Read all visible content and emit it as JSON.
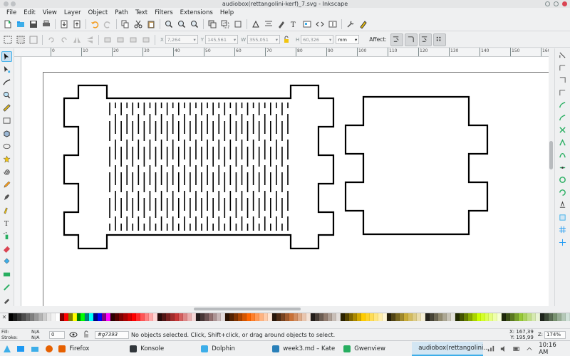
{
  "window": {
    "title": "audiobox(rettangolini-kerf)_7.svg - Inkscape"
  },
  "menu": [
    "File",
    "Edit",
    "View",
    "Layer",
    "Object",
    "Path",
    "Text",
    "Filters",
    "Extensions",
    "Help"
  ],
  "command_bar": {
    "icons": [
      "new-icon",
      "open-icon",
      "save-icon",
      "print-icon",
      "import-icon",
      "export-icon",
      "undo-icon",
      "redo-icon",
      "copy-icon",
      "cut-icon",
      "paste-icon",
      "zoom-selection-icon",
      "zoom-drawing-icon",
      "zoom-page-icon",
      "duplicate-icon",
      "clone-icon",
      "unlink-clone-icon",
      "group-icon",
      "ungroup-icon",
      "fill-stroke-icon",
      "text-font-icon",
      "layers-icon",
      "xml-editor-icon",
      "align-distribute-icon",
      "preferences-icon",
      "document-properties-icon"
    ]
  },
  "tool_controls": {
    "x_label": "X",
    "x_value": "7,264",
    "y_label": "Y",
    "y_value": "145,561",
    "w_label": "W",
    "w_value": "355,051",
    "h_label": "H",
    "h_value": "60,326",
    "unit": "mm",
    "affect_label": "Affect:"
  },
  "ruler": {
    "labels": [
      "0",
      "10",
      "20",
      "30",
      "40",
      "50",
      "60",
      "70",
      "80",
      "90",
      "100",
      "110",
      "120",
      "130",
      "140",
      "150",
      "160"
    ]
  },
  "toolbox": [
    "selector-arrow-icon",
    "node-tool-icon",
    "tweak-tool-icon",
    "zoom-tool-icon",
    "measure-tool-icon",
    "rectangle-tool-icon",
    "3d-box-tool-icon",
    "ellipse-tool-icon",
    "star-tool-icon",
    "spiral-tool-icon",
    "pencil-tool-icon",
    "pen-tool-icon",
    "calligraphy-tool-icon",
    "text-tool-icon",
    "spray-tool-icon",
    "eraser-tool-icon",
    "paint-bucket-icon",
    "gradient-tool-icon",
    "mesh-tool-icon",
    "dropper-tool-icon"
  ],
  "snap_toolbar": [
    "snap-enable-icon",
    "snap-bbox-icon",
    "snap-bbox-edge-icon",
    "snap-bbox-corner-icon",
    "snap-nodes-icon",
    "snap-path-icon",
    "snap-intersection-icon",
    "snap-cusp-icon",
    "snap-smooth-icon",
    "snap-midpoint-icon",
    "snap-center-icon",
    "snap-rotation-icon",
    "snap-text-baseline-icon",
    "snap-page-border-icon",
    "snap-grid-icon",
    "snap-guide-icon"
  ],
  "palette": {
    "colors": [
      "#000000",
      "#1a1a1a",
      "#333333",
      "#4d4d4d",
      "#666666",
      "#808080",
      "#999999",
      "#b3b3b3",
      "#cccccc",
      "#e6e6e6",
      "#f2f2f2",
      "#ffffff",
      "#800000",
      "#ff0000",
      "#808000",
      "#ffff00",
      "#008000",
      "#00ff00",
      "#008080",
      "#00ffff",
      "#000080",
      "#0000ff",
      "#800080",
      "#ff00ff",
      "#2b0000",
      "#550000",
      "#800000",
      "#aa0000",
      "#d40000",
      "#ff0000",
      "#ff2a2a",
      "#ff5555",
      "#ff8080",
      "#ffaaaa",
      "#ffd5d5",
      "#280b0b",
      "#501616",
      "#782121",
      "#a02c2c",
      "#c83737",
      "#d35f5f",
      "#de8787",
      "#e9afaf",
      "#f4d7d7",
      "#241c1c",
      "#483737",
      "#6c5353",
      "#916f6f",
      "#ac9393",
      "#c8b7b7",
      "#e3dbdb",
      "#2b1100",
      "#552200",
      "#803300",
      "#aa4400",
      "#d45500",
      "#ff6600",
      "#ff7f2a",
      "#ff9955",
      "#ffb380",
      "#ffccaa",
      "#ffe6d5",
      "#28170b",
      "#502d16",
      "#784421",
      "#a05a2c",
      "#c87137",
      "#d38d5f",
      "#deaa87",
      "#e9c6af",
      "#f4e3d7",
      "#241f1c",
      "#483e37",
      "#6c5d53",
      "#917c6f",
      "#ac9d93",
      "#c8beb7",
      "#e3dedb",
      "#2b2200",
      "#554400",
      "#806600",
      "#aa8800",
      "#d4aa00",
      "#ffcc00",
      "#ffd42a",
      "#ffdd55",
      "#ffe680",
      "#ffeeaa",
      "#fff6d5",
      "#28220b",
      "#504416",
      "#786721",
      "#a0892c",
      "#c8ab37",
      "#d3bc5f",
      "#decd87",
      "#e9ddaf",
      "#f4eed7",
      "#24221c",
      "#484537",
      "#6c6753",
      "#918a6f",
      "#aca793",
      "#c8c4b7",
      "#e3e2db",
      "#222b00",
      "#445500",
      "#668000",
      "#88aa00",
      "#aad400",
      "#ccff00",
      "#d4ff2a",
      "#ddff55",
      "#e5ff80",
      "#eeffaa",
      "#f6ffd5",
      "#1e280b",
      "#3c5016",
      "#5a7821",
      "#78a02c",
      "#96c837",
      "#abd35f",
      "#c0de87",
      "#d5e9af",
      "#eaf4d7",
      "#1e241c",
      "#3c4837",
      "#5a6c53",
      "#78916f",
      "#96ac93",
      "#b4c8b7",
      "#d2e3db"
    ]
  },
  "status": {
    "fill_label": "Fill:",
    "fill_value": "N/A",
    "stroke_label": "Stroke:",
    "stroke_value": "N/A",
    "opacity": "0",
    "layer": "#g7393",
    "message": "No objects selected. Click, Shift+click, or drag around objects to select.",
    "x_coord": "X:  167,39",
    "y_coord": "Y:  195,99",
    "zoom_label": "Z:",
    "zoom_value": "174%"
  },
  "taskbar": {
    "tasks": [
      {
        "label": "Firefox",
        "color": "#e66000"
      },
      {
        "label": "Konsole",
        "color": "#31363b"
      },
      {
        "label": "Dolphin",
        "color": "#3daee9"
      },
      {
        "label": "week3.md – Kate",
        "color": "#2980b9"
      },
      {
        "label": "Gwenview",
        "color": "#27ae60"
      },
      {
        "label": "audiobox(rettangolini...",
        "color": "#31363b"
      }
    ],
    "clock": "10:16 AM"
  }
}
